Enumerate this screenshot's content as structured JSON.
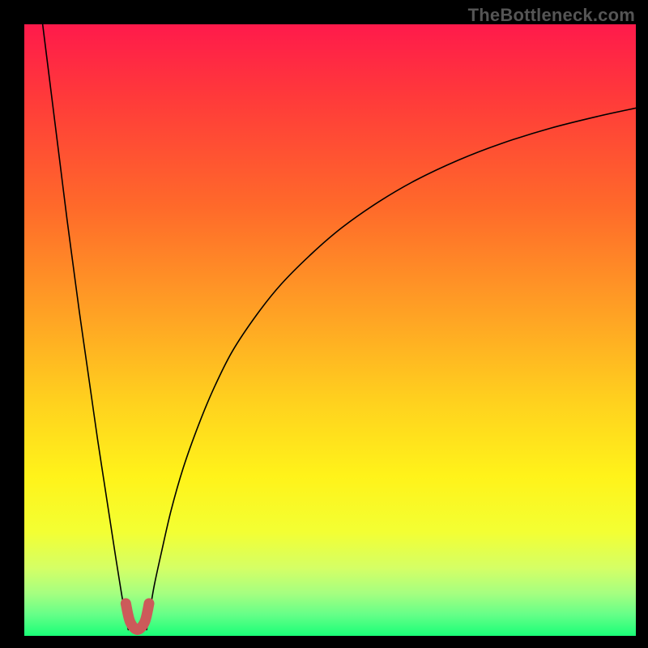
{
  "watermark": "TheBottleneck.com",
  "chart_data": {
    "type": "line",
    "title": "",
    "xlabel": "",
    "ylabel": "",
    "xlim": [
      0,
      100
    ],
    "ylim": [
      0,
      100
    ],
    "grid": false,
    "legend": false,
    "background_gradient_stops": [
      {
        "offset": 0.0,
        "color": "#ff1a4b"
      },
      {
        "offset": 0.12,
        "color": "#ff3a3a"
      },
      {
        "offset": 0.3,
        "color": "#ff6a2a"
      },
      {
        "offset": 0.48,
        "color": "#ffa424"
      },
      {
        "offset": 0.62,
        "color": "#ffd21e"
      },
      {
        "offset": 0.74,
        "color": "#fff31a"
      },
      {
        "offset": 0.83,
        "color": "#f3ff33"
      },
      {
        "offset": 0.89,
        "color": "#d4ff66"
      },
      {
        "offset": 0.93,
        "color": "#a6ff80"
      },
      {
        "offset": 0.965,
        "color": "#66ff88"
      },
      {
        "offset": 1.0,
        "color": "#1aff77"
      }
    ],
    "series": [
      {
        "name": "curve-left",
        "color": "#000000",
        "x": [
          3.0,
          4.0,
          5.0,
          6.0,
          7.0,
          8.0,
          9.0,
          10.0,
          11.0,
          12.0,
          13.0,
          14.0,
          15.0,
          15.8,
          16.4,
          17.0
        ],
        "y": [
          100.0,
          92.0,
          84.0,
          76.0,
          68.0,
          60.5,
          53.0,
          46.0,
          39.0,
          32.0,
          25.5,
          19.0,
          12.5,
          7.5,
          4.0,
          1.0
        ]
      },
      {
        "name": "curve-right",
        "color": "#000000",
        "x": [
          20.0,
          20.6,
          21.3,
          22.5,
          24.0,
          26.0,
          28.5,
          31.0,
          34.0,
          38.0,
          42.0,
          47.0,
          52.0,
          58.0,
          64.0,
          71.0,
          78.0,
          86.0,
          94.0,
          100.0
        ],
        "y": [
          1.0,
          4.5,
          8.5,
          14.0,
          20.5,
          27.5,
          34.5,
          40.5,
          46.5,
          52.5,
          57.5,
          62.5,
          66.8,
          71.0,
          74.5,
          77.8,
          80.5,
          83.0,
          85.0,
          86.3
        ]
      }
    ],
    "valley_marker": {
      "color": "#cc5a5a",
      "stroke_width": 13,
      "points_x": [
        16.6,
        17.3,
        18.5,
        19.7,
        20.4
      ],
      "points_y": [
        5.3,
        2.3,
        1.0,
        2.3,
        5.3
      ]
    }
  }
}
